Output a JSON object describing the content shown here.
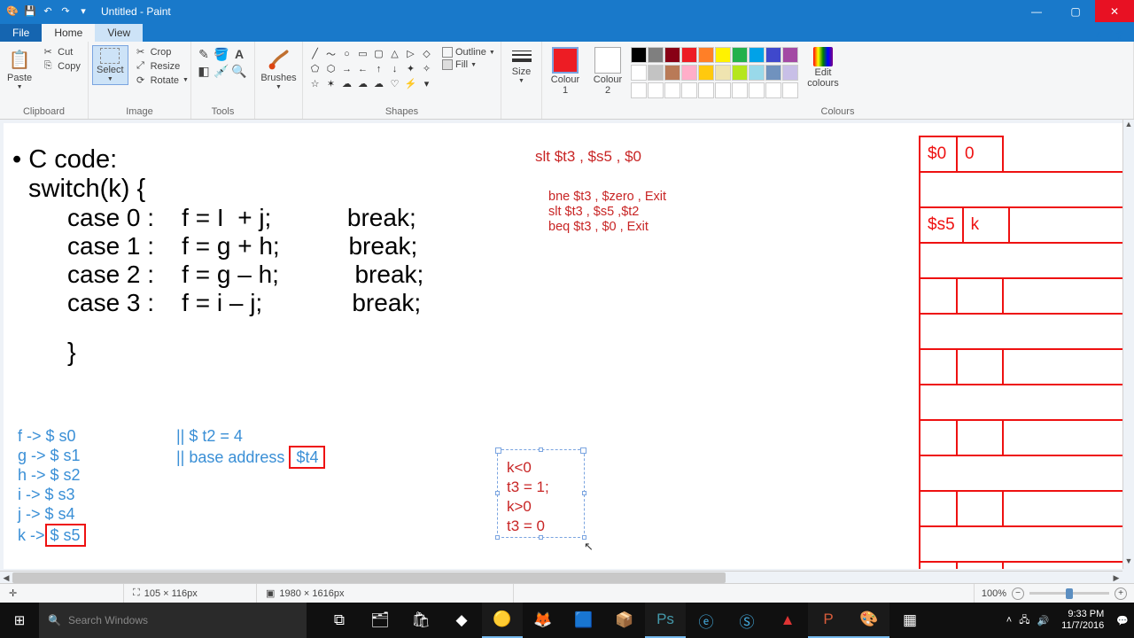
{
  "window": {
    "title": "Untitled - Paint",
    "qat": [
      "💾",
      "↶",
      "↷"
    ]
  },
  "tabs": {
    "file": "File",
    "home": "Home",
    "view": "View"
  },
  "ribbon": {
    "clipboard": {
      "label": "Clipboard",
      "paste": "Paste",
      "cut": "Cut",
      "copy": "Copy"
    },
    "image": {
      "label": "Image",
      "select": "Select",
      "crop": "Crop",
      "resize": "Resize",
      "rotate": "Rotate"
    },
    "tools": {
      "label": "Tools"
    },
    "brushes": {
      "label": "Brushes"
    },
    "shapes": {
      "label": "Shapes",
      "outline": "Outline",
      "fill": "Fill"
    },
    "size": {
      "label": "Size"
    },
    "colours": {
      "label": "Colours",
      "c1": "Colour 1",
      "c2": "Colour 2",
      "edit": "Edit colours"
    },
    "palette_row1": [
      "#000000",
      "#7f7f7f",
      "#880015",
      "#ed1c24",
      "#ff7f27",
      "#fff200",
      "#22b14c",
      "#00a2e8",
      "#3f48cc",
      "#a349a4"
    ],
    "palette_row2": [
      "#ffffff",
      "#c3c3c3",
      "#b97a57",
      "#ffaec9",
      "#ffc90e",
      "#efe4b0",
      "#b5e61d",
      "#99d9ea",
      "#7092be",
      "#c8bfe7"
    ],
    "palette_row3": [
      "#fff",
      "#fff",
      "#fff",
      "#fff",
      "#fff",
      "#fff",
      "#fff",
      "#fff",
      "#fff",
      "#fff"
    ]
  },
  "colours": {
    "c1": "#ed1c24",
    "c2": "#ffffff"
  },
  "canvas": {
    "ccode": {
      "hdr": "• C code:",
      "sw": "switch(k) {",
      "cases": [
        "case 0 :    f = I  + j;           break;",
        "case 1 :    f = g + h;          break;",
        "case 2 :    f = g – h;           break;",
        "case 3 :    f = i – j;             break;"
      ],
      "end": "}"
    },
    "regmap": [
      "f -> $ s0",
      "g -> $ s1",
      "h -> $ s2",
      "i  -> $ s3",
      "j  -> $ s4"
    ],
    "regmap_boxed": {
      "prefix": "k ->",
      "box": "$ s5"
    },
    "notes": {
      "l0": "||  $ t2 = 4",
      "l1_prefix": "||   base address ",
      "l1_box": "$t4"
    },
    "asm1": "slt  $t3 , $s5 , $0",
    "asm2": [
      "bne $t3 , $zero , Exit",
      "slt  $t3 , $s5 ,$t2",
      "beq  $t3 , $0 , Exit"
    ],
    "sel_text": [
      "  k<0",
      "t3 = 1;",
      "k>0",
      "t3 = 0"
    ],
    "regtable": {
      "r0c0": "$0",
      "r0c1": "0",
      "r1c0": "$s5",
      "r1c1": "k"
    }
  },
  "status": {
    "pos": "",
    "sel": "105 × 116px",
    "size": "1980 × 1616px",
    "zoom": "100%"
  },
  "taskbar": {
    "search_ph": "Search Windows",
    "time": "9:33 PM",
    "date": "11/7/2016"
  }
}
